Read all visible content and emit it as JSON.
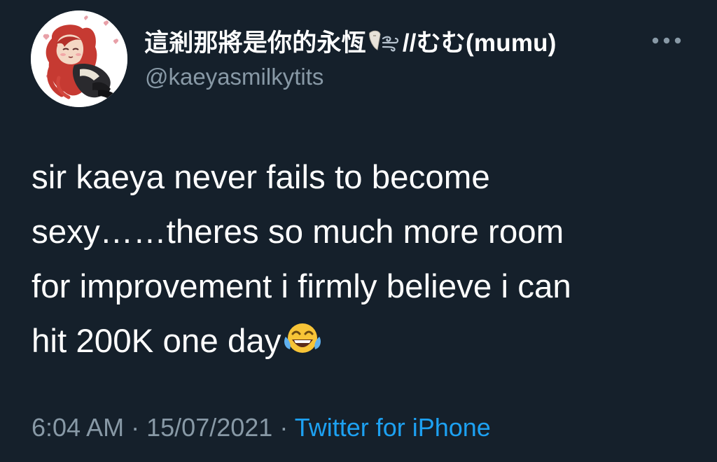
{
  "tweet": {
    "display_name_text": "這剎那將是你的永恆",
    "display_name_suffix": "//むむ(mumu)",
    "handle": "@kaeyasmilkytits",
    "text_lines": [
      "sir kaeya never fails to become",
      "sexy……theres so much more room",
      "for improvement i firmly believe i can",
      "hit 200K one day"
    ],
    "time": "6:04 AM",
    "separator": "·",
    "date": "15/07/2021",
    "source": "Twitter for iPhone"
  },
  "icons": {
    "more": "more-horizontal-icon",
    "name_emoji": "wind-blowing-icon",
    "text_emoji": "face-with-tears-of-joy-icon"
  },
  "colors": {
    "background": "#15202b",
    "primary_text": "#ffffff",
    "secondary_text": "#8899a6",
    "link": "#1da1f2"
  }
}
